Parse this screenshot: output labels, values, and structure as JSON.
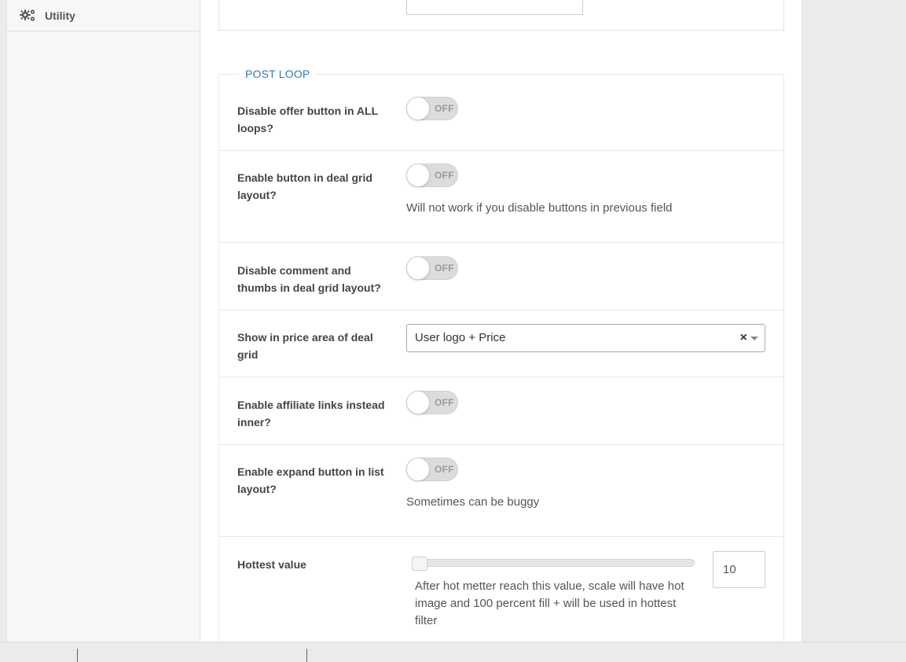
{
  "sidebar": {
    "items": [
      {
        "label": "Utility",
        "icon": "gears-icon"
      }
    ]
  },
  "section": {
    "title": "POST LOOP",
    "accent_color": "#2c7bb6",
    "rows": [
      {
        "label": "Disable offer button in ALL loops?",
        "toggle": "OFF"
      },
      {
        "label": "Enable button in deal grid layout?",
        "toggle": "OFF",
        "description": "Will not work if you disable buttons in previous field"
      },
      {
        "label": "Disable comment and thumbs in deal grid layout?",
        "toggle": "OFF"
      },
      {
        "label": "Show in price area of deal grid",
        "select_value": "User logo + Price",
        "clear": "×"
      },
      {
        "label": "Enable affiliate links instead inner?",
        "toggle": "OFF"
      },
      {
        "label": "Enable expand button in list layout?",
        "toggle": "OFF",
        "description": "Sometimes can be buggy"
      },
      {
        "label": "Hottest value",
        "slider_value": 10,
        "slider_max": 100,
        "input_value": "10",
        "description": "After hot metter reach this value, scale will have hot image and 100 percent fill + will be used in hottest filter"
      }
    ]
  }
}
